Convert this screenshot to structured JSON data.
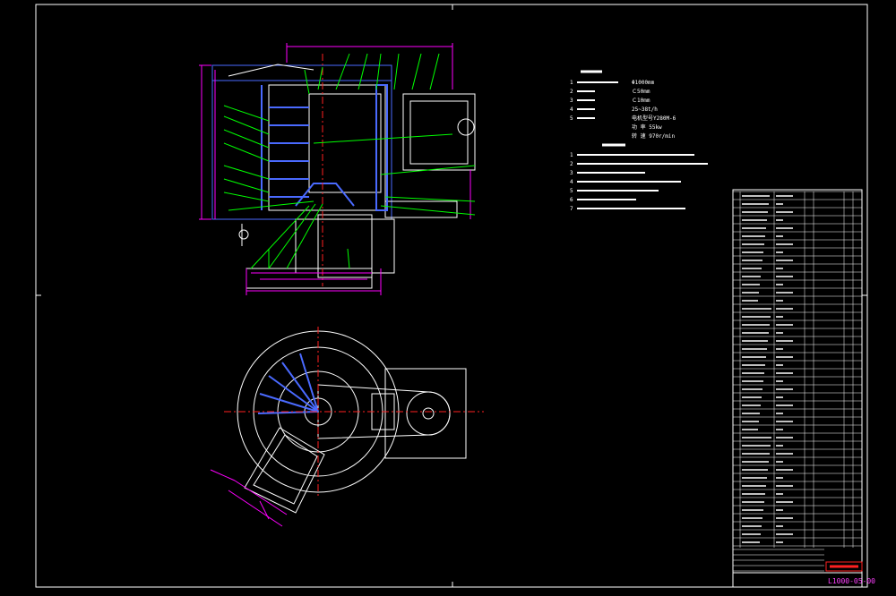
{
  "colors": {
    "frame": "#ffffff",
    "part": "#ffffff",
    "leader": "#00ff00",
    "dimension": "#ff00ff",
    "hidden": "#4a6aff",
    "center": "#ff2020",
    "note": "#ffffff",
    "title_accent": "#ff2020",
    "drawing_number": "#ff40ff"
  },
  "spec_table": {
    "rows": [
      {
        "no": "1",
        "value": "Φ1000mm"
      },
      {
        "no": "2",
        "value": "Ｃ50mm"
      },
      {
        "no": "3",
        "value": "Ｃ10mm"
      },
      {
        "no": "4",
        "value": "25~38t/h"
      },
      {
        "no": "5",
        "value": "电机型号Y280M-6"
      },
      {
        "no": "",
        "value": "功  率  55kw"
      },
      {
        "no": "",
        "value": "转  速  970r/min"
      }
    ]
  },
  "notes": {
    "lines": [
      "1",
      "2",
      "3",
      "4",
      "5",
      "6",
      "7"
    ]
  },
  "title_block": {
    "drawing_number": "L1000-05-00"
  }
}
